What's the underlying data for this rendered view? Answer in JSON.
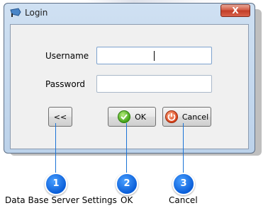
{
  "window": {
    "title": "Login",
    "close_label": "X"
  },
  "form": {
    "username_label": "Username",
    "username_value": "",
    "password_label": "Password",
    "password_value": ""
  },
  "buttons": {
    "settings_label": "<<",
    "ok_label": "OK",
    "cancel_label": "Cancel"
  },
  "callouts": [
    {
      "number": "1",
      "caption": "Data Base Server Settings"
    },
    {
      "number": "2",
      "caption": "OK"
    },
    {
      "number": "3",
      "caption": "Cancel"
    }
  ],
  "colors": {
    "callout_blue": "#0a5ed8",
    "close_red": "#c13c27",
    "window_frame": "#bcd2ea"
  }
}
